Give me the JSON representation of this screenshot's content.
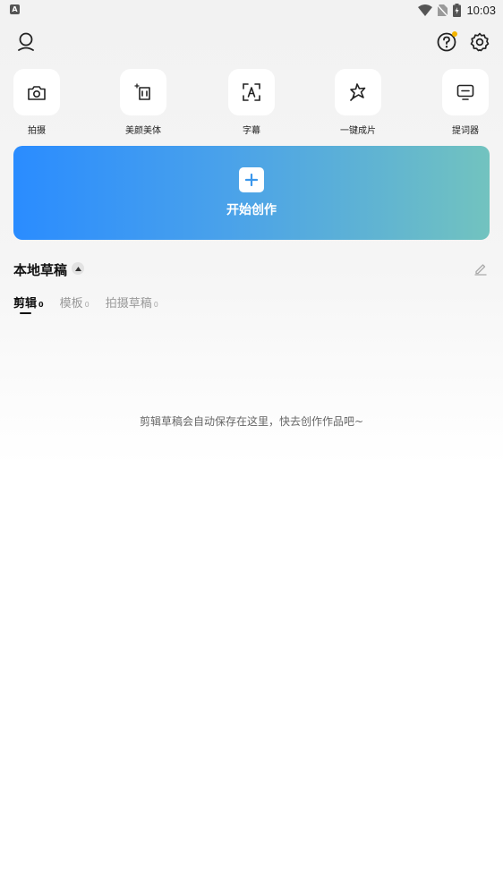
{
  "status_bar": {
    "app_badge": "A",
    "time": "10:03",
    "icons": [
      "wifi-icon",
      "no-sim-icon",
      "battery-charging-icon"
    ]
  },
  "top_bar": {
    "icons": [
      "profile-icon",
      "help-icon",
      "settings-icon"
    ],
    "notification_dot_color": "#f4b400"
  },
  "tools": [
    {
      "label": "拍摄",
      "icon": "camera-icon"
    },
    {
      "label": "美颜美体",
      "icon": "beauty-icon"
    },
    {
      "label": "字幕",
      "icon": "subtitle-icon"
    },
    {
      "label": "一键成片",
      "icon": "one-click-icon"
    },
    {
      "label": "提词器",
      "icon": "teleprompter-icon"
    }
  ],
  "create": {
    "label": "开始创作",
    "gradient": [
      "#2a8cff",
      "#72c3bf"
    ]
  },
  "drafts": {
    "title": "本地草稿",
    "tabs": [
      {
        "label": "剪辑",
        "count": "0",
        "active": true
      },
      {
        "label": "模板",
        "count": "0",
        "active": false
      },
      {
        "label": "拍摄草稿",
        "count": "0",
        "active": false
      }
    ],
    "empty_message": "剪辑草稿会自动保存在这里，快去创作作品吧~"
  }
}
